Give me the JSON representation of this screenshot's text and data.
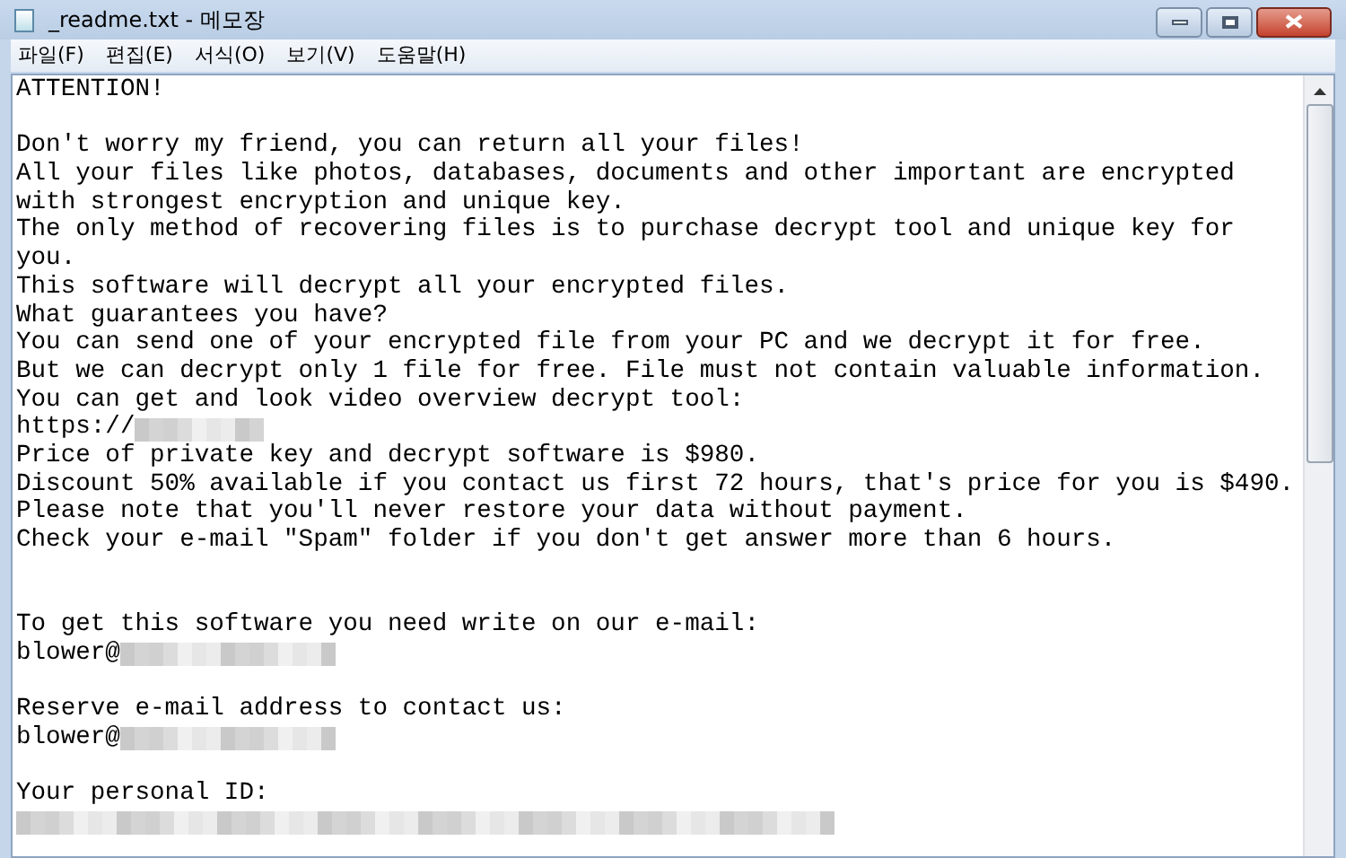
{
  "window": {
    "title": "_readme.txt - 메모장"
  },
  "menu": [
    "파일(F)",
    "편집(E)",
    "서식(O)",
    "보기(V)",
    "도움말(H)"
  ],
  "lines": [
    {
      "kind": "text",
      "text": "ATTENTION!"
    },
    {
      "kind": "blank"
    },
    {
      "kind": "text",
      "text": "Don't worry my friend, you can return all your files!"
    },
    {
      "kind": "text",
      "text": "All your files like photos, databases, documents and other important are encrypted"
    },
    {
      "kind": "text",
      "text": "with strongest encryption and unique key."
    },
    {
      "kind": "text",
      "text": "The only method of recovering files is to purchase decrypt tool and unique key for"
    },
    {
      "kind": "text",
      "text": "you."
    },
    {
      "kind": "text",
      "text": "This software will decrypt all your encrypted files."
    },
    {
      "kind": "text",
      "text": "What guarantees you have?"
    },
    {
      "kind": "text",
      "text": "You can send one of your encrypted file from your PC and we decrypt it for free."
    },
    {
      "kind": "text",
      "text": "But we can decrypt only 1 file for free. File must not contain valuable information."
    },
    {
      "kind": "text",
      "text": "You can get and look video overview decrypt tool:"
    },
    {
      "kind": "redacted",
      "text": "https://"
    },
    {
      "kind": "text",
      "text": "Price of private key and decrypt software is $980."
    },
    {
      "kind": "text",
      "text": "Discount 50% available if you contact us first 72 hours, that's price for you is $490."
    },
    {
      "kind": "text",
      "text": "Please note that you'll never restore your data without payment."
    },
    {
      "kind": "text",
      "text": "Check your e-mail \"Spam\" folder if you don't get answer more than 6 hours."
    },
    {
      "kind": "blank"
    },
    {
      "kind": "blank"
    },
    {
      "kind": "text",
      "text": "To get this software you need write on our e-mail:"
    },
    {
      "kind": "redacted",
      "text": "blower@"
    },
    {
      "kind": "blank"
    },
    {
      "kind": "text",
      "text": "Reserve e-mail address to contact us:"
    },
    {
      "kind": "redacted",
      "text": "blower@"
    },
    {
      "kind": "blank"
    },
    {
      "kind": "text",
      "text": "Your personal ID:"
    },
    {
      "kind": "redacted"
    }
  ]
}
